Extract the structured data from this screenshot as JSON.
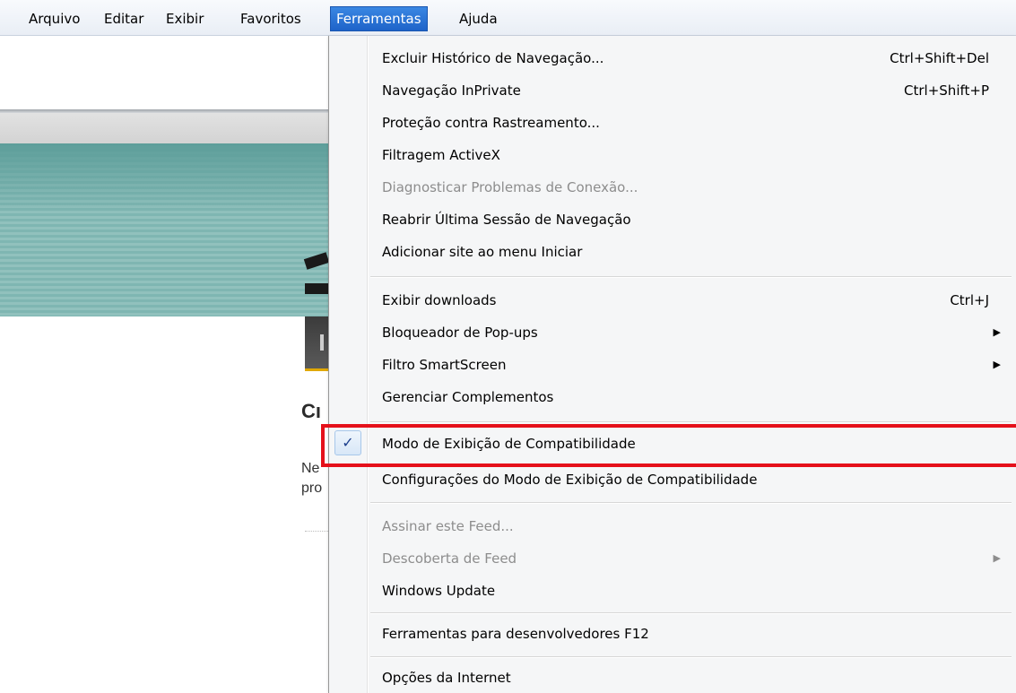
{
  "menubar": {
    "items": [
      {
        "label": "Arquivo"
      },
      {
        "label": "Editar"
      },
      {
        "label": "Exibir"
      },
      {
        "label": "Favoritos"
      },
      {
        "label": "Ferramentas"
      },
      {
        "label": "Ajuda"
      }
    ],
    "active_item": "Ferramentas"
  },
  "page": {
    "heading_fragment": "Cı",
    "para_line1_fragment": "Ne",
    "para_line2_fragment": "pro"
  },
  "tools_menu": {
    "items": [
      {
        "label": "Excluir Histórico de Navegação...",
        "shortcut": "Ctrl+Shift+Del"
      },
      {
        "label": "Navegação InPrivate",
        "shortcut": "Ctrl+Shift+P"
      },
      {
        "label": "Proteção contra Rastreamento..."
      },
      {
        "label": "Filtragem ActiveX"
      },
      {
        "label": "Diagnosticar Problemas de Conexão...",
        "disabled": true
      },
      {
        "label": "Reabrir Última Sessão de Navegação"
      },
      {
        "label": "Adicionar site ao menu Iniciar"
      },
      {
        "label": "Exibir downloads",
        "shortcut": "Ctrl+J"
      },
      {
        "label": "Bloqueador de Pop-ups",
        "submenu": true
      },
      {
        "label": "Filtro SmartScreen",
        "submenu": true
      },
      {
        "label": "Gerenciar Complementos"
      },
      {
        "label": "Modo de Exibição de Compatibilidade",
        "checked": true,
        "check_glyph": "✓"
      },
      {
        "label": "Configurações do Modo de Exibição de Compatibilidade"
      },
      {
        "label": "Assinar este Feed...",
        "disabled": true
      },
      {
        "label": "Descoberta de Feed",
        "disabled": true,
        "submenu": true
      },
      {
        "label": "Windows Update"
      },
      {
        "label": "Ferramentas para desenvolvedores F12"
      },
      {
        "label": "Opções da Internet"
      }
    ],
    "arrow_glyph": "▶"
  },
  "colors": {
    "menu_active_bg": "#1e63c9",
    "highlight_border": "#e5101a",
    "disabled_text": "#8d8d8d"
  }
}
